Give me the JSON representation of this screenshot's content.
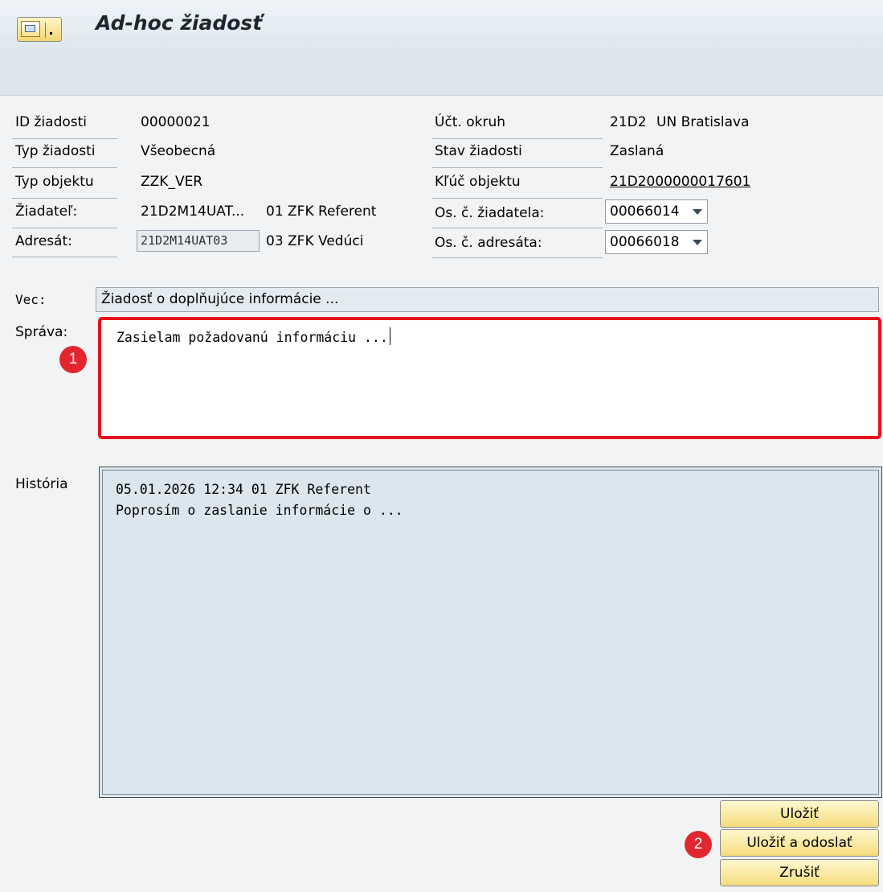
{
  "header": {
    "title": "Ad-hoc žiadosť",
    "menu_icon": "sap-menu-icon"
  },
  "form": {
    "id_label": "ID žiadosti",
    "id_value": "00000021",
    "type_label": "Typ žiadosti",
    "type_value": "Všeobecná",
    "obj_type_label": "Typ objektu",
    "obj_type_value": "ZZK_VER",
    "requester_label": "Žiadateľ:",
    "requester_id": "21D2M14UAT...",
    "requester_role": "01 ZFK Referent",
    "addressee_label": "Adresát:",
    "addressee_id": "21D2M14UAT03",
    "addressee_role": "03 ZFK Vedúci",
    "acct_label": "Účt. okruh",
    "acct_code": "21D2",
    "acct_name": "UN Bratislava",
    "status_label": "Stav žiadosti",
    "status_value": "Zaslaná",
    "obj_key_label": "Kľúč objektu",
    "obj_key_value": "21D2000000017601",
    "req_num_label": "Os. č. žiadatela:",
    "req_num_value": "00066014",
    "addr_num_label": "Os. č. adresáta:",
    "addr_num_value": "00066018"
  },
  "subject": {
    "label": "Vec:",
    "value": "Žiadosť o doplňujúce informácie ..."
  },
  "message": {
    "label": "Správa:",
    "value": "Zasielam požadovanú informáciu ..."
  },
  "history": {
    "label": "História",
    "lines": [
      "05.01.2026 12:34 01 ZFK Referent",
      "Poprosím o zaslanie informácie o ..."
    ]
  },
  "buttons": {
    "save": "Uložiť",
    "save_send": "Uložiť a odoslať",
    "cancel": "Zrušiť"
  },
  "annotations": {
    "badge1": "1",
    "badge2": "2"
  },
  "colors": {
    "highlight": "#e8101e",
    "button": "#f5dc7c"
  }
}
